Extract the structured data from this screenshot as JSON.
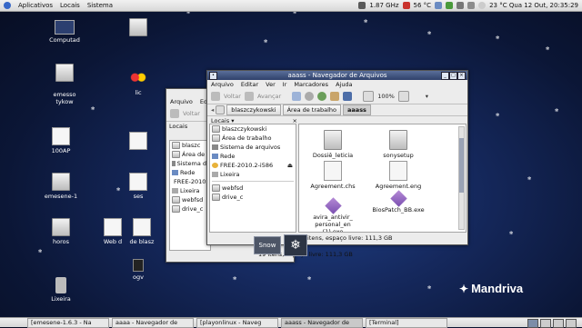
{
  "topbar": {
    "menus": [
      "Aplicativos",
      "Locais",
      "Sistema"
    ],
    "cpu": "1.87 GHz",
    "temp": "56 °C",
    "clock": "23 °C Qua 12 Out, 20:35:29"
  },
  "desktop": {
    "icons": [
      "Computad",
      "emesso\ntykow",
      "100AP",
      "emesene-1",
      "horos",
      "Lixeira",
      "Web d",
      "de blasz",
      "ogv",
      "ses",
      "lic"
    ]
  },
  "bg_window": {
    "menu": [
      "Arquivo",
      "Edit"
    ],
    "back": "Voltar",
    "places_label": "Locais",
    "places": [
      "blaszc",
      "Área de",
      "Sistema de",
      "Rede",
      "FREE-2010...",
      "Lixeira",
      "webfsd",
      "drive_c"
    ],
    "status": "19 itens, espaço livre: 111,3 GB"
  },
  "window": {
    "title": "aaass - Navegador de Arquivos",
    "menu": [
      "Arquivo",
      "Editar",
      "Ver",
      "Ir",
      "Marcadores",
      "Ajuda"
    ],
    "back": "Voltar",
    "forward": "Avançar",
    "zoom": "100%",
    "path": [
      "blaszczykowski",
      "Área de trabalho",
      "aaass"
    ],
    "places_label": "Locais",
    "places": [
      "blaszczykowski",
      "Área de trabalho",
      "Sistema de arquivos",
      "Rede",
      "FREE-2010.2-i586",
      "Lixeira",
      "webfsd",
      "drive_c"
    ],
    "files": [
      {
        "name": "Dossiê_leticia",
        "kind": "folder"
      },
      {
        "name": "sonysetup",
        "kind": "folder"
      },
      {
        "name": "Agreement.chs",
        "kind": "doc"
      },
      {
        "name": "Agreement.eng",
        "kind": "doc"
      },
      {
        "name": "avira_antivir_\npersonal_en (1).exe",
        "kind": "exe"
      },
      {
        "name": "BiosPatch_BB.exe",
        "kind": "exe"
      }
    ],
    "status": "itens, espaço livre: 111,3 GB"
  },
  "snow": {
    "label": "Snow",
    "icon": "snowflake-icon"
  },
  "brand": "Mandriva",
  "taskbar": [
    "[emesene-1.6.3 - Na",
    "aaaa - Navegador de",
    "[playonlinux - Naveg",
    "aaass - Navegador de",
    "[Terminal]"
  ],
  "colors": {
    "title_bar": "#3a4d78",
    "desktop": "#15285c",
    "highlight": "#cfcfcf"
  }
}
